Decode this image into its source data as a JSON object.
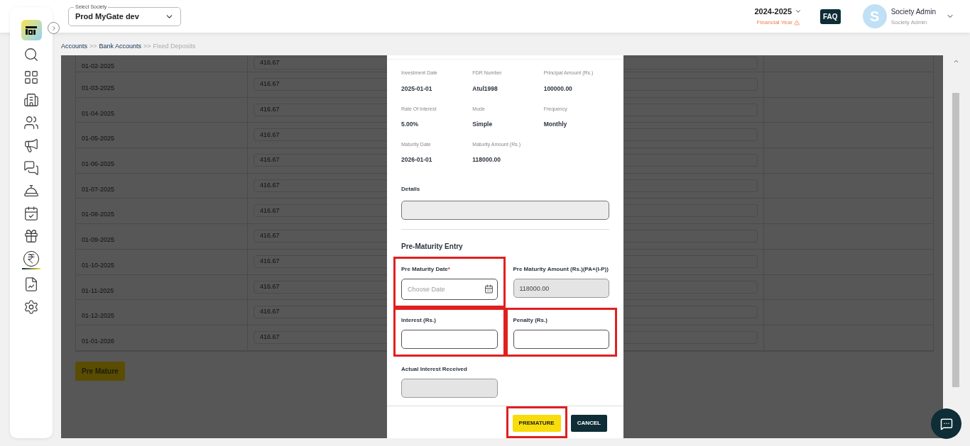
{
  "header": {
    "society_select": {
      "label": "Select Society",
      "value": "Prod MyGate dev"
    },
    "year": "2024-2025",
    "year_caption": "Financial Year",
    "faq": "FAQ",
    "user": {
      "initial": "S",
      "name": "Society Admin",
      "role": "Society Admin"
    }
  },
  "sidebar": {
    "items": [
      {
        "selected": false
      },
      {
        "selected": false
      },
      {
        "selected": false
      },
      {
        "selected": false
      },
      {
        "selected": false
      },
      {
        "selected": false
      },
      {
        "selected": false
      },
      {
        "selected": false
      },
      {
        "selected": false
      },
      {
        "selected": true
      },
      {
        "selected": false
      },
      {
        "selected": false
      }
    ]
  },
  "breadcrumb": [
    {
      "label": "Accounts",
      "current": false
    },
    {
      "label": "Bank Accounts",
      "current": false
    },
    {
      "label": "Fixed Deposits",
      "current": true
    }
  ],
  "breadcrumb_separator": ">>",
  "schedule": {
    "rows": [
      {
        "date": "01-02-2025",
        "amount": "416.67"
      },
      {
        "date": "01-03-2025",
        "amount": "416.67"
      },
      {
        "date": "01-04-2025",
        "amount": "416.67"
      },
      {
        "date": "01-05-2025",
        "amount": "416.67"
      },
      {
        "date": "01-06-2025",
        "amount": "416.67"
      },
      {
        "date": "01-07-2025",
        "amount": "416.67"
      },
      {
        "date": "01-08-2025",
        "amount": "416.67"
      },
      {
        "date": "01-09-2025",
        "amount": "416.67"
      },
      {
        "date": "01-10-2025",
        "amount": "416.67"
      },
      {
        "date": "01-11-2025",
        "amount": "416.67"
      },
      {
        "date": "01-12-2025",
        "amount": "416.67"
      },
      {
        "date": "01-01-2026",
        "amount": "416.67"
      }
    ],
    "button": "Pre Mature"
  },
  "dialog": {
    "details": [
      {
        "label": "Investment Date",
        "value": "2025-01-01"
      },
      {
        "label": "FDR Number",
        "value": "Atul1998"
      },
      {
        "label": "Principal Amount (Rs.)",
        "value": "100000.00"
      },
      {
        "label": "Rate Of Interest",
        "value": "5.00%"
      },
      {
        "label": "Mode",
        "value": "Simple"
      },
      {
        "label": "Frequency",
        "value": "Monthly"
      },
      {
        "label": "Maturity Date",
        "value": "2026-01-01"
      },
      {
        "label": "Maturity Amount (Rs.)",
        "value": "118000.00"
      }
    ],
    "details_field": {
      "label": "Details"
    },
    "section_title": "Pre-Maturity Entry",
    "required_mark": "*",
    "fields": [
      {
        "kind": "date",
        "label": "Pre Maturity Date",
        "required": true,
        "placeholder": "Choose Date",
        "highlighted": true,
        "disabled": false
      },
      {
        "kind": "text",
        "label": "Pre Maturity Amount (Rs.)(PA+(I-P))",
        "required": false,
        "value": "118000.00",
        "highlighted": false,
        "disabled": true
      },
      {
        "kind": "text",
        "label": "Interest (Rs.)",
        "required": false,
        "highlighted": true,
        "disabled": false
      },
      {
        "kind": "text",
        "label": "Penalty (Rs.)",
        "required": false,
        "highlighted": true,
        "disabled": false
      },
      {
        "kind": "text",
        "label": "Actual Interest Received",
        "required": false,
        "highlighted": false,
        "disabled": true
      }
    ],
    "buttons": [
      {
        "label": "PREMATURE",
        "kind": "primary",
        "highlighted": true
      },
      {
        "label": "CANCEL",
        "kind": "secondary",
        "highlighted": false
      }
    ]
  }
}
